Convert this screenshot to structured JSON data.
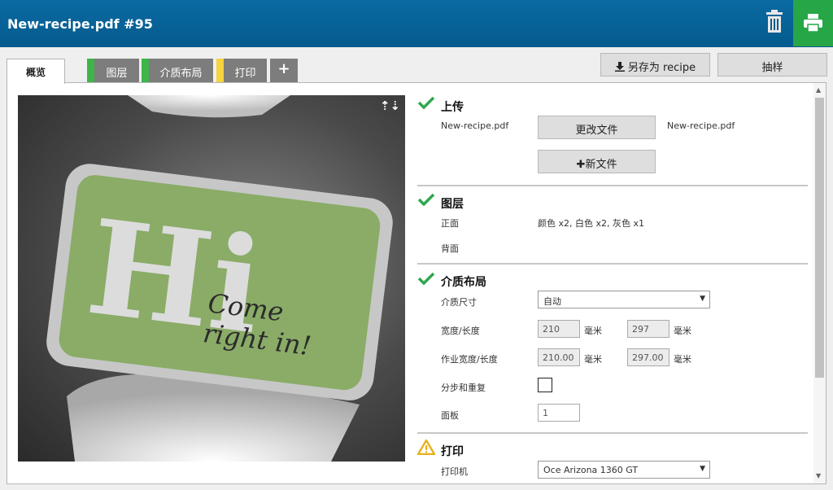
{
  "header": {
    "title": "New-recipe.pdf #95",
    "delete_icon": "trash-icon",
    "print_icon": "printer-icon",
    "colors": {
      "bar": "#045b8d",
      "print_button": "#26a646"
    }
  },
  "tabs": [
    {
      "label": "概览",
      "active": true
    },
    {
      "label": "图层",
      "color": "#3db549"
    },
    {
      "label": "介质布局",
      "color": "#3db549"
    },
    {
      "label": "打印",
      "color": "#f5d43c"
    },
    {
      "label": "+"
    }
  ],
  "toolbar": {
    "save_as_recipe": "另存为 recipe",
    "sample": "抽样"
  },
  "preview": {
    "sign_text_big": "Hi",
    "sign_text_line1": "Come",
    "sign_text_line2": "right in!",
    "arrows": "⇡⇣"
  },
  "upload": {
    "title": "上传",
    "status": "ok",
    "filename": "New-recipe.pdf",
    "change_file": "更改文件",
    "filename_right": "New-recipe.pdf",
    "new_file": "新文件"
  },
  "layers": {
    "title": "图层",
    "status": "ok",
    "front_label": "正面",
    "front_value": "颜色 x2, 白色 x2, 灰色 x1",
    "back_label": "背面"
  },
  "media_layout": {
    "title": "介质布局",
    "status": "ok",
    "media_size_label": "介质尺寸",
    "media_size_value": "自动",
    "width_length_label": "宽度/长度",
    "width": "210",
    "length": "297",
    "unit": "毫米",
    "job_width_length_label": "作业宽度/长度",
    "job_width": "210.00",
    "job_length": "297.00",
    "step_repeat_label": "分步和重复",
    "panels_label": "面板",
    "panels": "1"
  },
  "print": {
    "title": "打印",
    "status": "warning",
    "printer_label": "打印机",
    "printer_value": "Oce Arizona 1360 GT"
  }
}
